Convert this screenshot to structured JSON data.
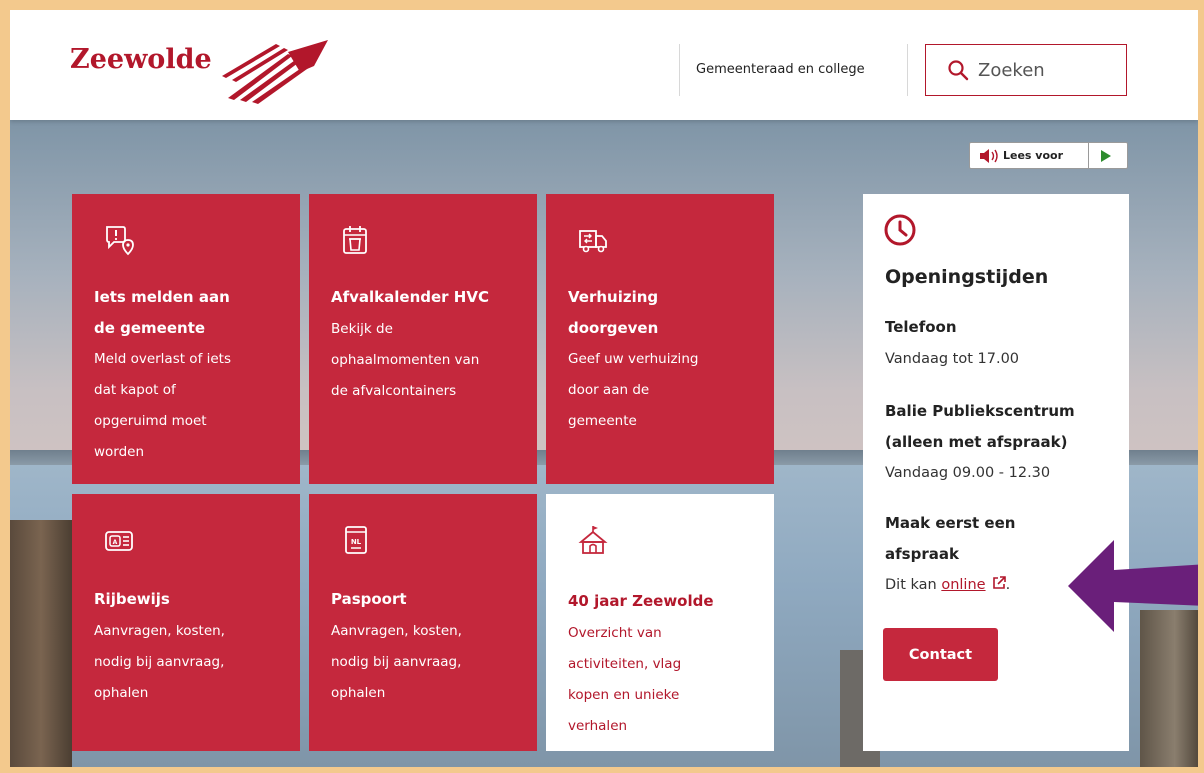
{
  "header": {
    "logo_text": "Zeewolde",
    "nav_link": "Gemeenteraad en college",
    "search_placeholder": "Zoeken"
  },
  "readaloud": {
    "label": "Lees voor"
  },
  "tiles": [
    {
      "icon": "report-location-icon",
      "title": "Iets melden aan de gemeente",
      "title_lines": [
        "Iets melden aan",
        "de gemeente"
      ],
      "desc_lines": [
        "Meld overlast of iets",
        "dat kapot of",
        "opgeruimd moet",
        "worden"
      ]
    },
    {
      "icon": "calendar-bin-icon",
      "title_lines": [
        "Afvalkalender HVC"
      ],
      "desc_lines": [
        "Bekijk de",
        "ophaalmomenten van",
        "de afvalcontainers"
      ]
    },
    {
      "icon": "moving-truck-icon",
      "title_lines": [
        "Verhuizing",
        "doorgeven"
      ],
      "desc_lines": [
        "Geef uw verhuizing",
        "door aan de",
        "gemeente"
      ]
    },
    {
      "icon": "driving-license-icon",
      "title_lines": [
        "Rijbewijs"
      ],
      "desc_lines": [
        "Aanvragen, kosten,",
        "nodig bij aanvraag,",
        "ophalen"
      ]
    },
    {
      "icon": "passport-icon",
      "title_lines": [
        "Paspoort"
      ],
      "desc_lines": [
        "Aanvragen, kosten,",
        "nodig bij aanvraag,",
        "ophalen"
      ]
    },
    {
      "icon": "tent-icon",
      "title_lines": [
        "40 jaar Zeewolde"
      ],
      "desc_lines": [
        "Overzicht van",
        "activiteiten, vlag",
        "kopen en unieke",
        "verhalen"
      ]
    }
  ],
  "hours": {
    "title": "Openingstijden",
    "phone_label": "Telefoon",
    "phone_value": "Vandaag tot 17.00",
    "desk_label_1": "Balie Publiekscentrum",
    "desk_label_2": "(alleen met afspraak)",
    "desk_value": "Vandaag 09.00 - 12.30",
    "appt_label_1": "Maak eerst een",
    "appt_label_2": "afspraak",
    "appt_prefix": "Dit kan",
    "appt_link": "online",
    "appt_suffix": ".",
    "contact_button": "Contact"
  },
  "colors": {
    "brand_red": "#c5283d",
    "accent_purple": "#6a1f7a",
    "frame": "#f3c98d"
  }
}
